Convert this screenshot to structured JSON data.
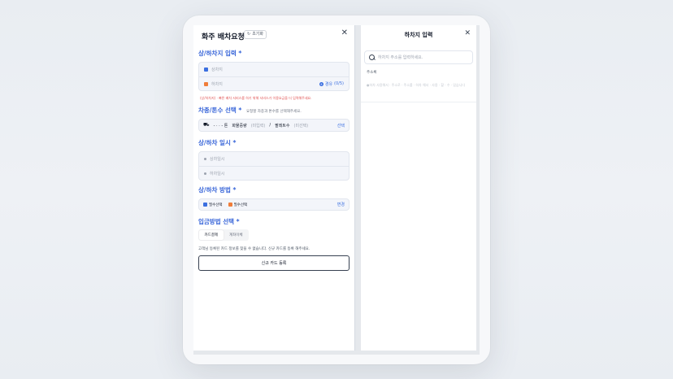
{
  "left_panel": {
    "title": "화주 배차요청",
    "reset_label": "초기화",
    "reset_icon": "refresh-icon",
    "close_icon": "close-icon",
    "sections": {
      "load": {
        "title": "상/하차지 입력",
        "required": "*",
        "pickup_placeholder": "상차지",
        "dropoff_placeholder": "하차지",
        "via_label": "경유",
        "via_count": "(0/5)",
        "warning": "(상/하차지) · 빠른 배차 서비스를 하기 위해 서비스가 이용요금을 더 입력해주세요."
      },
      "vehicle": {
        "title": "차종/톤수 선택",
        "required": "*",
        "hint": "요청할 차종과 톤수를 선택해주세요.",
        "ton_text": "- · · - 톤",
        "cargo_weight_label": "화물중량",
        "cargo_weight_value": "(미입력)",
        "separator": "/",
        "pallet_label": "팔레트수",
        "pallet_value": "(미선택)",
        "action": "선택"
      },
      "schedule": {
        "title": "상/하차 일시",
        "required": "*",
        "pickup_time": "상차일시",
        "dropoff_time": "하차일시"
      },
      "method": {
        "title": "상/하차 방법",
        "required": "*",
        "pickup_method": "필수선택",
        "dropoff_method": "필수선택",
        "action": "변경"
      },
      "payment": {
        "title": "입금방법 선택",
        "required": "*",
        "tabs": [
          {
            "label": "카드결제",
            "active": true
          },
          {
            "label": "계좌이체",
            "active": false
          }
        ],
        "notice": "고객님 등록된 카드 정보를 찾을 수 없습니다. 신규 카드를 등록 해주세요.",
        "register_button": "신규 카드 등록"
      }
    }
  },
  "right_panel": {
    "title": "하차지 입력",
    "close_icon": "close-icon",
    "search_placeholder": "하차지 주소를 입력하세요.",
    "search_icon": "search-icon",
    "address_label": "주소록",
    "address_guide": "●하차 사용해서 · 주소로 · 주소를 · 하차 해서 · 사용 · 할 · 수 · 있습니다"
  },
  "colors": {
    "accent": "#3563d8",
    "pickup": "#3b6fe0",
    "dropoff": "#f07d3a",
    "warning": "#e05252"
  }
}
